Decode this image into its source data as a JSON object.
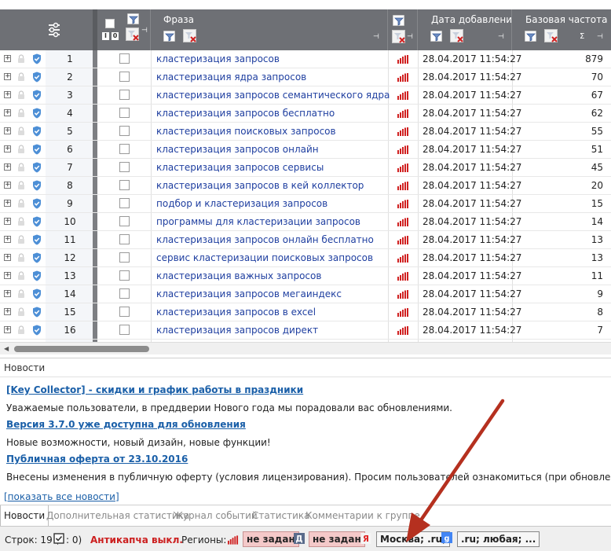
{
  "grid": {
    "headers": {
      "phrase": "Фраза",
      "date_added": "Дата добавлени",
      "base_freq": "Базовая частота",
      "sigma": "Σ"
    },
    "rows": [
      {
        "num": "1",
        "phrase": "кластеризация запросов",
        "date": "28.04.2017 11:54:27",
        "freq": "879"
      },
      {
        "num": "2",
        "phrase": "кластеризация ядра запросов",
        "date": "28.04.2017 11:54:27",
        "freq": "70"
      },
      {
        "num": "3",
        "phrase": "кластеризация запросов семантического ядра",
        "date": "28.04.2017 11:54:27",
        "freq": "67"
      },
      {
        "num": "4",
        "phrase": "кластеризация запросов бесплатно",
        "date": "28.04.2017 11:54:27",
        "freq": "62"
      },
      {
        "num": "5",
        "phrase": "кластеризация поисковых запросов",
        "date": "28.04.2017 11:54:27",
        "freq": "55"
      },
      {
        "num": "6",
        "phrase": "кластеризация запросов онлайн",
        "date": "28.04.2017 11:54:27",
        "freq": "51"
      },
      {
        "num": "7",
        "phrase": "кластеризация запросов сервисы",
        "date": "28.04.2017 11:54:27",
        "freq": "45"
      },
      {
        "num": "8",
        "phrase": "кластеризация запросов в кей коллектор",
        "date": "28.04.2017 11:54:27",
        "freq": "20"
      },
      {
        "num": "9",
        "phrase": "подбор и кластеризация запросов",
        "date": "28.04.2017 11:54:27",
        "freq": "15"
      },
      {
        "num": "10",
        "phrase": "программы для кластеризации запросов",
        "date": "28.04.2017 11:54:27",
        "freq": "14"
      },
      {
        "num": "11",
        "phrase": "кластеризация запросов онлайн бесплатно",
        "date": "28.04.2017 11:54:27",
        "freq": "13"
      },
      {
        "num": "12",
        "phrase": "сервис кластеризации поисковых запросов",
        "date": "28.04.2017 11:54:27",
        "freq": "13"
      },
      {
        "num": "13",
        "phrase": "кластеризация важных запросов",
        "date": "28.04.2017 11:54:27",
        "freq": "11"
      },
      {
        "num": "14",
        "phrase": "кластеризация запросов мегаиндекс",
        "date": "28.04.2017 11:54:27",
        "freq": "9"
      },
      {
        "num": "15",
        "phrase": "кластеризация запросов в excel",
        "date": "28.04.2017 11:54:27",
        "freq": "8"
      },
      {
        "num": "16",
        "phrase": "кластеризация запросов директ",
        "date": "28.04.2017 11:54:27",
        "freq": "7"
      }
    ]
  },
  "news": {
    "title": "Новости",
    "items": [
      {
        "link": "[Key Collector] - скидки и график работы в праздники",
        "text": "Уважаемые пользователи, в преддверии Нового года мы порадовали вас обновлениями."
      },
      {
        "link": "Версия 3.7.0 уже доступна для обновления",
        "text": "Новые возможности, новый дизайн, новые функции!"
      },
      {
        "link": "Публичная оферта от 23.10.2016",
        "text": "Внесены изменения в публичную оферту (условия лицензирования). Просим пользователей ознакомиться (при обновлении программа ув"
      }
    ],
    "show_all": "[показать все новости]"
  },
  "tabs": [
    "Новости",
    "Дополнительная статистика",
    "Журнал событий",
    "Статистика",
    "Комментарии к группе"
  ],
  "status": {
    "rows_label": "Строк: 19 (",
    "rows_suffix": ": 0)",
    "anticaptcha": "Антикапча выкл.",
    "regions_label": "Регионы:",
    "region_1": "не задан",
    "region_2": "не задан",
    "region_3": "Москва; .ru;",
    "region_4": ".ru; любая; ..."
  },
  "colors": {
    "header_bg": "#6e7075",
    "link": "#1a5fa8",
    "phrase": "#1f3fa0",
    "alert_red": "#cc1f1f",
    "arrow": "#b5301f"
  }
}
